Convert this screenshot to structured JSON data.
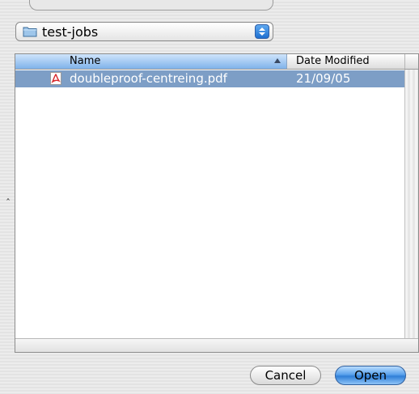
{
  "location": {
    "folder_name": "test-jobs",
    "folder_icon": "folder-icon",
    "popup_icon": "updown-arrows-icon"
  },
  "file_list": {
    "columns": [
      {
        "label": "Name",
        "sorted": true,
        "sort_direction": "ascending"
      },
      {
        "label": "Date Modified"
      }
    ],
    "rows": [
      {
        "name": "doubleproof-centreing.pdf",
        "date_modified": "21/09/05",
        "icon": "pdf-file-icon",
        "selected": true
      }
    ]
  },
  "buttons": {
    "cancel_label": "Cancel",
    "open_label": "Open",
    "default_button": "Open"
  },
  "colors": {
    "selection": "#7d9ec6",
    "sorted_header": "#7fb2ea",
    "default_button": "#2f7fd8"
  }
}
